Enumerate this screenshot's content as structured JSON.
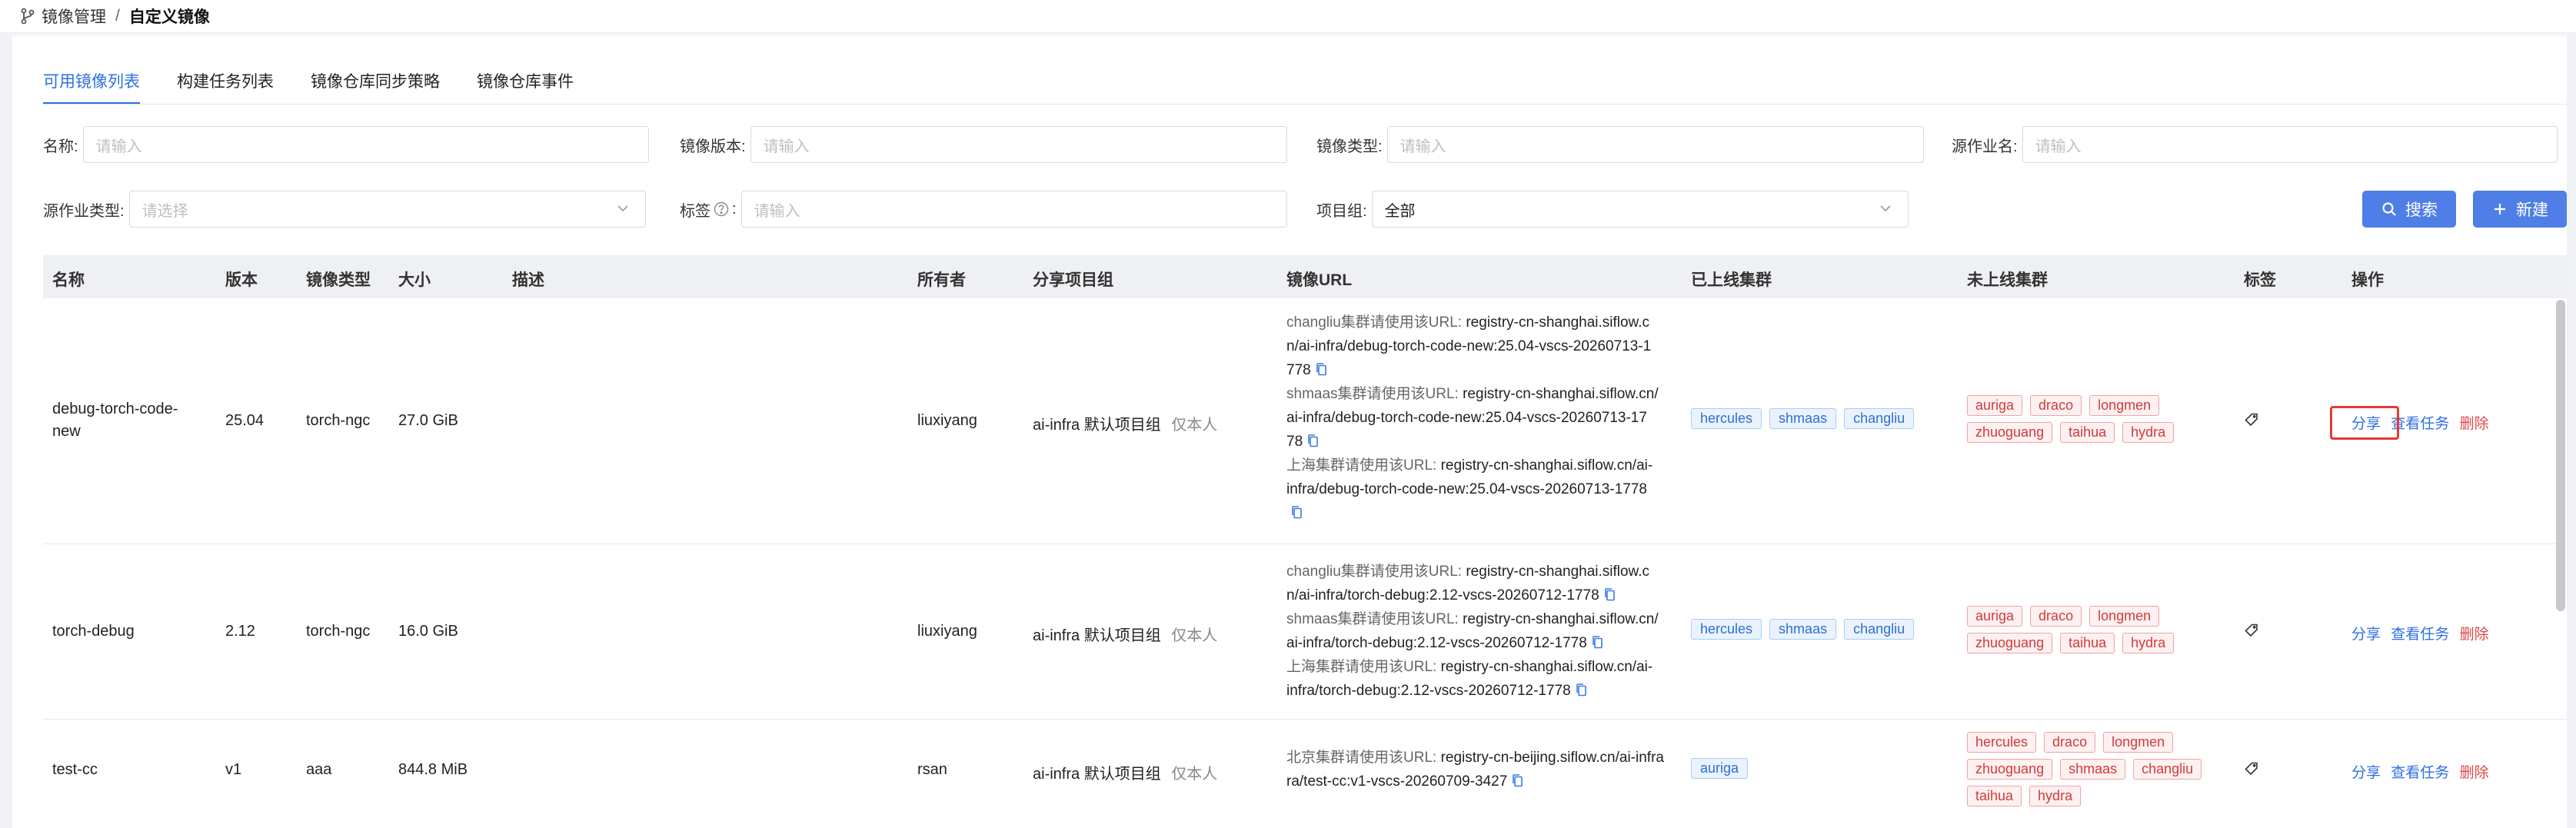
{
  "breadcrumb": {
    "parent": "镜像管理",
    "separator": "/",
    "current": "自定义镜像"
  },
  "tabs": [
    {
      "label": "可用镜像列表",
      "active": true
    },
    {
      "label": "构建任务列表",
      "active": false
    },
    {
      "label": "镜像仓库同步策略",
      "active": false
    },
    {
      "label": "镜像仓库事件",
      "active": false
    }
  ],
  "filters": {
    "name": {
      "label": "名称:",
      "placeholder": "请输入"
    },
    "version": {
      "label": "镜像版本:",
      "placeholder": "请输入"
    },
    "type": {
      "label": "镜像类型:",
      "placeholder": "请输入"
    },
    "source_job": {
      "label": "源作业名:",
      "placeholder": "请输入"
    },
    "source_job_type": {
      "label": "源作业类型:",
      "placeholder": "请选择"
    },
    "tags": {
      "label": "标签",
      "placeholder": "请输入"
    },
    "project_group": {
      "label": "项目组:",
      "value": "全部"
    }
  },
  "buttons": {
    "search": "搜索",
    "create": "新建"
  },
  "table": {
    "headers": {
      "name": "名称",
      "version": "版本",
      "type": "镜像类型",
      "size": "大小",
      "desc": "描述",
      "owner": "所有者",
      "share": "分享项目组",
      "url": "镜像URL",
      "online": "已上线集群",
      "offline": "未上线集群",
      "tags": "标签",
      "ops": "操作"
    },
    "rows": [
      {
        "name_line1": "debug-torch-code-",
        "name_line2": "new",
        "version": "25.04",
        "type": "torch-ngc",
        "size": "27.0 GiB",
        "owner": "liuxiyang",
        "share_group": "ai-infra 默认项目组",
        "share_note": "仅本人",
        "url_lines": [
          {
            "prefix": "changliu集群请使用该URL: ",
            "text": "registry-cn-shanghai.siflow.c"
          },
          {
            "prefix": "",
            "text": "n/ai-infra/debug-torch-code-new:25.04-vscs-20260713-1"
          },
          {
            "prefix": "",
            "text": "778",
            "copy": true
          },
          {
            "prefix": "shmaas集群请使用该URL: ",
            "text": "registry-cn-shanghai.siflow.cn/"
          },
          {
            "prefix": "",
            "text": "ai-infra/debug-torch-code-new:25.04-vscs-20260713-17"
          },
          {
            "prefix": "",
            "text": "78",
            "copy": true
          },
          {
            "prefix": "上海集群请使用该URL: ",
            "text": "registry-cn-shanghai.siflow.cn/ai-"
          },
          {
            "prefix": "",
            "text": "infra/debug-torch-code-new:25.04-vscs-20260713-1778"
          },
          {
            "prefix": "",
            "text": "",
            "copy": true
          }
        ],
        "online": [
          "hercules",
          "shmaas",
          "changliu"
        ],
        "offline_rows": [
          [
            "auriga",
            "draco",
            "longmen"
          ],
          [
            "zhuoguang",
            "taihua",
            "hydra"
          ]
        ],
        "ops": {
          "share": "分享",
          "view": "查看任务",
          "delete": "删除"
        }
      },
      {
        "name_line1": "torch-debug",
        "name_line2": "",
        "version": "2.12",
        "type": "torch-ngc",
        "size": "16.0 GiB",
        "owner": "liuxiyang",
        "share_group": "ai-infra 默认项目组",
        "share_note": "仅本人",
        "url_lines": [
          {
            "prefix": "changliu集群请使用该URL: ",
            "text": "registry-cn-shanghai.siflow.c"
          },
          {
            "prefix": "",
            "text": "n/ai-infra/torch-debug:2.12-vscs-20260712-1778",
            "copy": true
          },
          {
            "prefix": "shmaas集群请使用该URL: ",
            "text": "registry-cn-shanghai.siflow.cn/"
          },
          {
            "prefix": "",
            "text": "ai-infra/torch-debug:2.12-vscs-20260712-1778",
            "copy": true
          },
          {
            "prefix": "上海集群请使用该URL: ",
            "text": "registry-cn-shanghai.siflow.cn/ai-"
          },
          {
            "prefix": "",
            "text": "infra/torch-debug:2.12-vscs-20260712-1778",
            "copy": true
          }
        ],
        "online": [
          "hercules",
          "shmaas",
          "changliu"
        ],
        "offline_rows": [
          [
            "auriga",
            "draco",
            "longmen"
          ],
          [
            "zhuoguang",
            "taihua",
            "hydra"
          ]
        ],
        "ops": {
          "share": "分享",
          "view": "查看任务",
          "delete": "删除"
        }
      },
      {
        "name_line1": "test-cc",
        "name_line2": "",
        "version": "v1",
        "type": "aaa",
        "size": "844.8 MiB",
        "owner": "rsan",
        "share_group": "ai-infra 默认项目组",
        "share_note": "仅本人",
        "url_lines": [
          {
            "prefix": "北京集群请使用该URL: ",
            "text": "registry-cn-beijing.siflow.cn/ai-infra"
          },
          {
            "prefix": "",
            "text": "ra/test-cc:v1-vscs-20260709-3427",
            "copy": true
          }
        ],
        "online": [
          "auriga"
        ],
        "offline_rows": [
          [
            "hercules",
            "draco",
            "longmen"
          ],
          [
            "zhuoguang",
            "shmaas",
            "changliu"
          ],
          [
            "taihua",
            "hydra"
          ]
        ],
        "ops": {
          "share": "分享",
          "view": "查看任务",
          "delete": "删除"
        }
      }
    ]
  },
  "colors": {
    "primary": "#2f6fe0",
    "button": "#4f7fe6",
    "danger": "#e04848",
    "highlight": "#e53935"
  },
  "icons": [
    "branch-icon",
    "help-icon",
    "chevron-down-icon",
    "search-icon",
    "plus-icon",
    "copy-icon",
    "tag-icon"
  ]
}
